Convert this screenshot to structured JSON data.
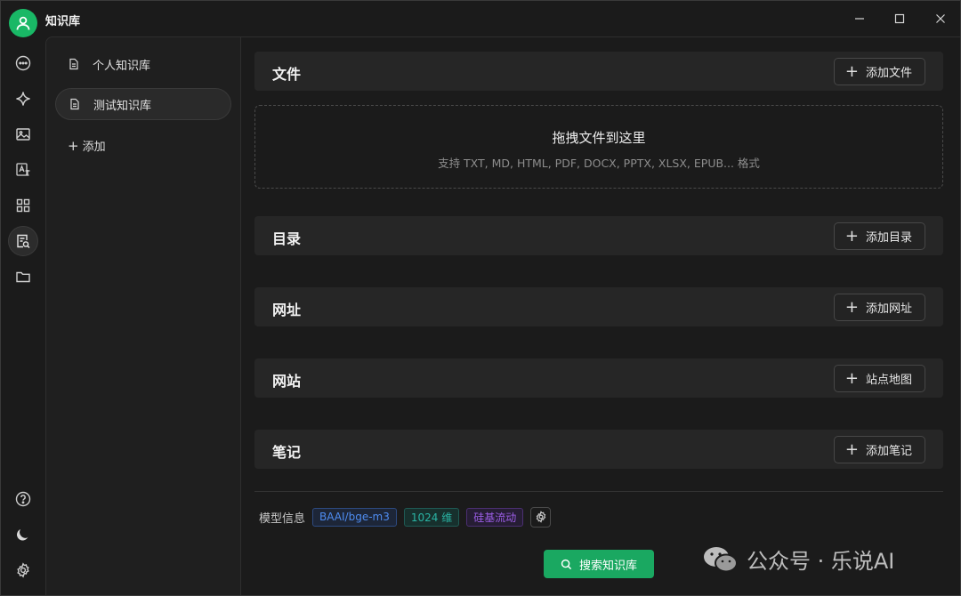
{
  "app": {
    "title": "知识库"
  },
  "window_controls": {
    "minimize": "—",
    "maximize": "☐",
    "close": "✕"
  },
  "sidebar": {
    "items": [
      {
        "label": "个人知识库",
        "active": false
      },
      {
        "label": "测试知识库",
        "active": true
      }
    ],
    "add_label": "添加"
  },
  "main": {
    "files": {
      "title": "文件",
      "button": "添加文件"
    },
    "dropzone": {
      "title": "拖拽文件到这里",
      "subtitle": "支持 TXT, MD, HTML, PDF, DOCX, PPTX, XLSX, EPUB... 格式"
    },
    "directory": {
      "title": "目录",
      "button": "添加目录"
    },
    "url": {
      "title": "网址",
      "button": "添加网址"
    },
    "website": {
      "title": "网站",
      "button": "站点地图"
    },
    "notes": {
      "title": "笔记",
      "button": "添加笔记"
    },
    "model_info": {
      "label": "模型信息",
      "tags": [
        {
          "text": "BAAI/bge-m3",
          "color": "#4e8cf0"
        },
        {
          "text": "1024 维",
          "color": "#2ab3a3"
        },
        {
          "text": "硅基流动",
          "color": "#9b5de5"
        }
      ]
    },
    "search_button": "搜索知识库"
  },
  "watermark": {
    "text": "公众号 · 乐说AI"
  },
  "colors": {
    "accent": "#1aa861",
    "avatar": "#19b866"
  }
}
